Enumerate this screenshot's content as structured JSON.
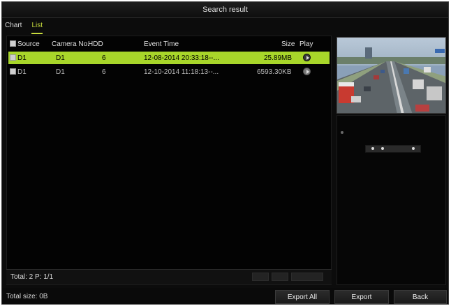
{
  "window": {
    "title": "Search result"
  },
  "tabs": [
    {
      "label": "Chart",
      "active": false
    },
    {
      "label": "List",
      "active": true
    }
  ],
  "columns": {
    "source": "Source",
    "camera": "Camera No.",
    "hdd": "HDD",
    "event_time": "Event Time",
    "size": "Size",
    "play": "Play"
  },
  "rows": [
    {
      "source": "D1",
      "camera": "D1",
      "hdd": "6",
      "event_time": "12-08-2014 20:33:18--...",
      "size": "25.89MB",
      "selected": true
    },
    {
      "source": "D1",
      "camera": "D1",
      "hdd": "6",
      "event_time": "12-10-2014 11:18:13--...",
      "size": "6593.30KB",
      "selected": false
    }
  ],
  "footer": {
    "total": "Total: 2  P: 1/1"
  },
  "bottom": {
    "total_size": "Total size: 0B",
    "export_all_label": "Export All",
    "export_label": "Export",
    "back_label": "Back"
  },
  "colors": {
    "selected_row": "#a8d62a",
    "active_tab": "#c8dc3c",
    "background": "#0c0c0c"
  }
}
